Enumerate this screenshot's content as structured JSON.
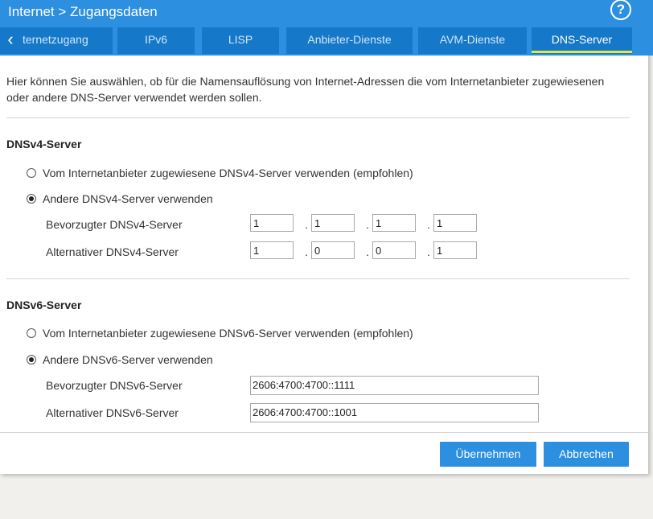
{
  "header": {
    "title": "Internet > Zugangsdaten",
    "help_label": "?"
  },
  "tabs": {
    "back_icon": "chevron-left-icon",
    "items": [
      {
        "label": "Internetzugang",
        "visible_text": "ternetzugang"
      },
      {
        "label": "IPv6"
      },
      {
        "label": "LISP"
      },
      {
        "label": "Anbieter-Dienste"
      },
      {
        "label": "AVM-Dienste"
      },
      {
        "label": "DNS-Server",
        "active": true
      }
    ]
  },
  "intro": "Hier können Sie auswählen, ob für die Namensauflösung von Internet-Adressen die vom Internetanbieter zugewiesenen oder andere DNS-Server verwendet werden sollen.",
  "dnsv4": {
    "title": "DNSv4-Server",
    "option_provider": "Vom Internetanbieter zugewiesene DNSv4-Server verwenden (empfohlen)",
    "option_other": "Andere DNSv4-Server verwenden",
    "selected": "other",
    "preferred_label": "Bevorzugter DNSv4-Server",
    "preferred": [
      "1",
      "1",
      "1",
      "1"
    ],
    "alternative_label": "Alternativer DNSv4-Server",
    "alternative": [
      "1",
      "0",
      "0",
      "1"
    ]
  },
  "dnsv6": {
    "title": "DNSv6-Server",
    "option_provider": "Vom Internetanbieter zugewiesene DNSv6-Server verwenden (empfohlen)",
    "option_other": "Andere DNSv6-Server verwenden",
    "selected": "other",
    "preferred_label": "Bevorzugter DNSv6-Server",
    "preferred": "2606:4700:4700::1111",
    "alternative_label": "Alternativer DNSv6-Server",
    "alternative": "2606:4700:4700::1001"
  },
  "buttons": {
    "apply": "Übernehmen",
    "cancel": "Abbrechen"
  },
  "colors": {
    "accent": "#2c8fdf",
    "tab": "#1678c8",
    "active_underline": "#e8e83a"
  }
}
